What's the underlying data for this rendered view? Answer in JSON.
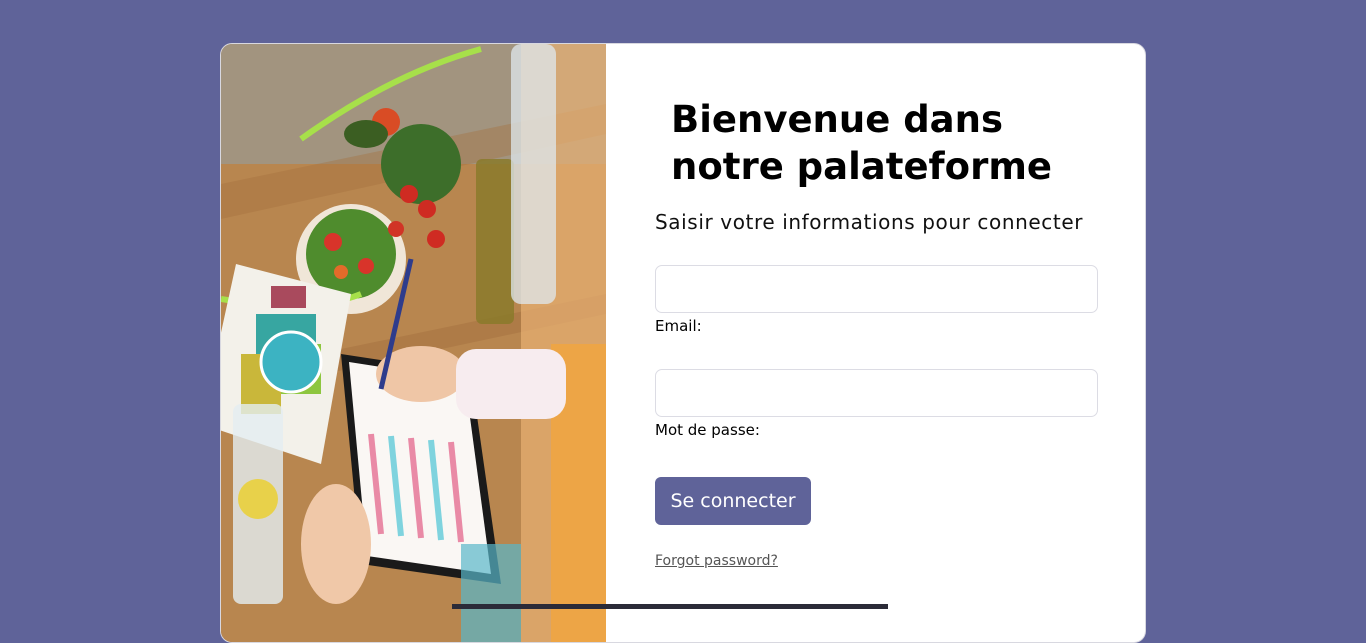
{
  "page": {
    "title_line1": "Bienvenue dans",
    "title_line2": "notre palateforme",
    "subtitle": "Saisir votre informations pour connecter"
  },
  "form": {
    "email_label": "Email:",
    "email_value": "",
    "password_label": "Mot de passe:",
    "password_value": "",
    "submit_label": "Se connecter",
    "forgot_link": "Forgot password?"
  },
  "colors": {
    "background": "#5f6399",
    "accent": "#5f6399",
    "card": "#ffffff"
  },
  "illustration": {
    "subject": "nutrition-planning-photo"
  }
}
